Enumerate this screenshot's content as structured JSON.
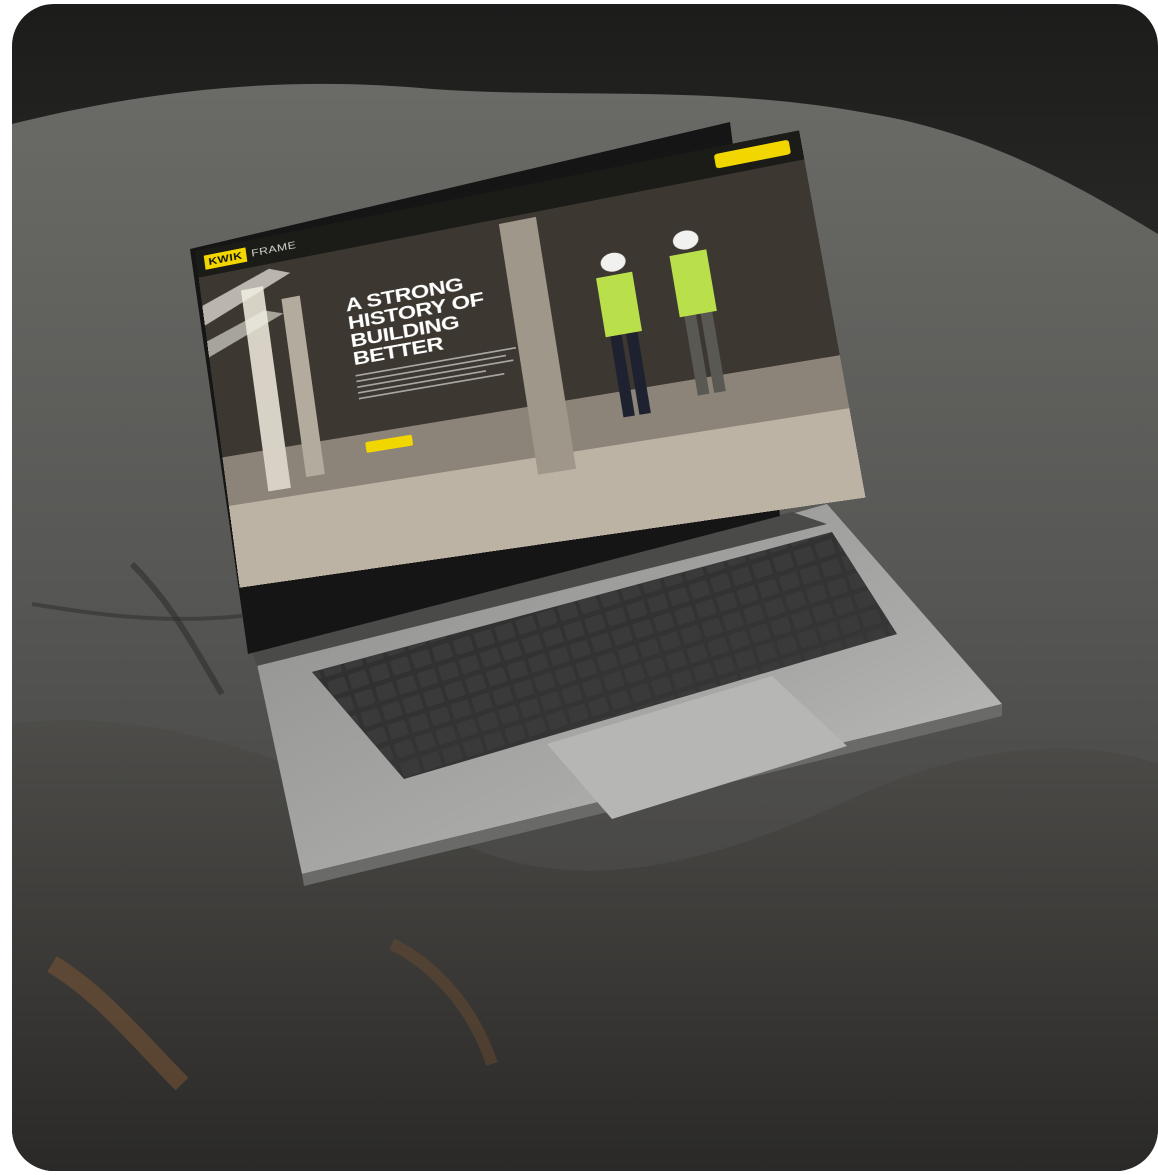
{
  "website": {
    "logo": {
      "mark": "KWIK",
      "text": "FRAME"
    },
    "nav_links": [
      "",
      "",
      "",
      "",
      ""
    ],
    "hero": {
      "headline": "A STRONG\nHISTORY OF\nBUILDING\nBETTER"
    }
  },
  "colors": {
    "brand_yellow": "#f2d600",
    "nav_dark": "#1a1a16",
    "rock": "#4a4a48",
    "laptop_silver": "#9a9a98"
  }
}
